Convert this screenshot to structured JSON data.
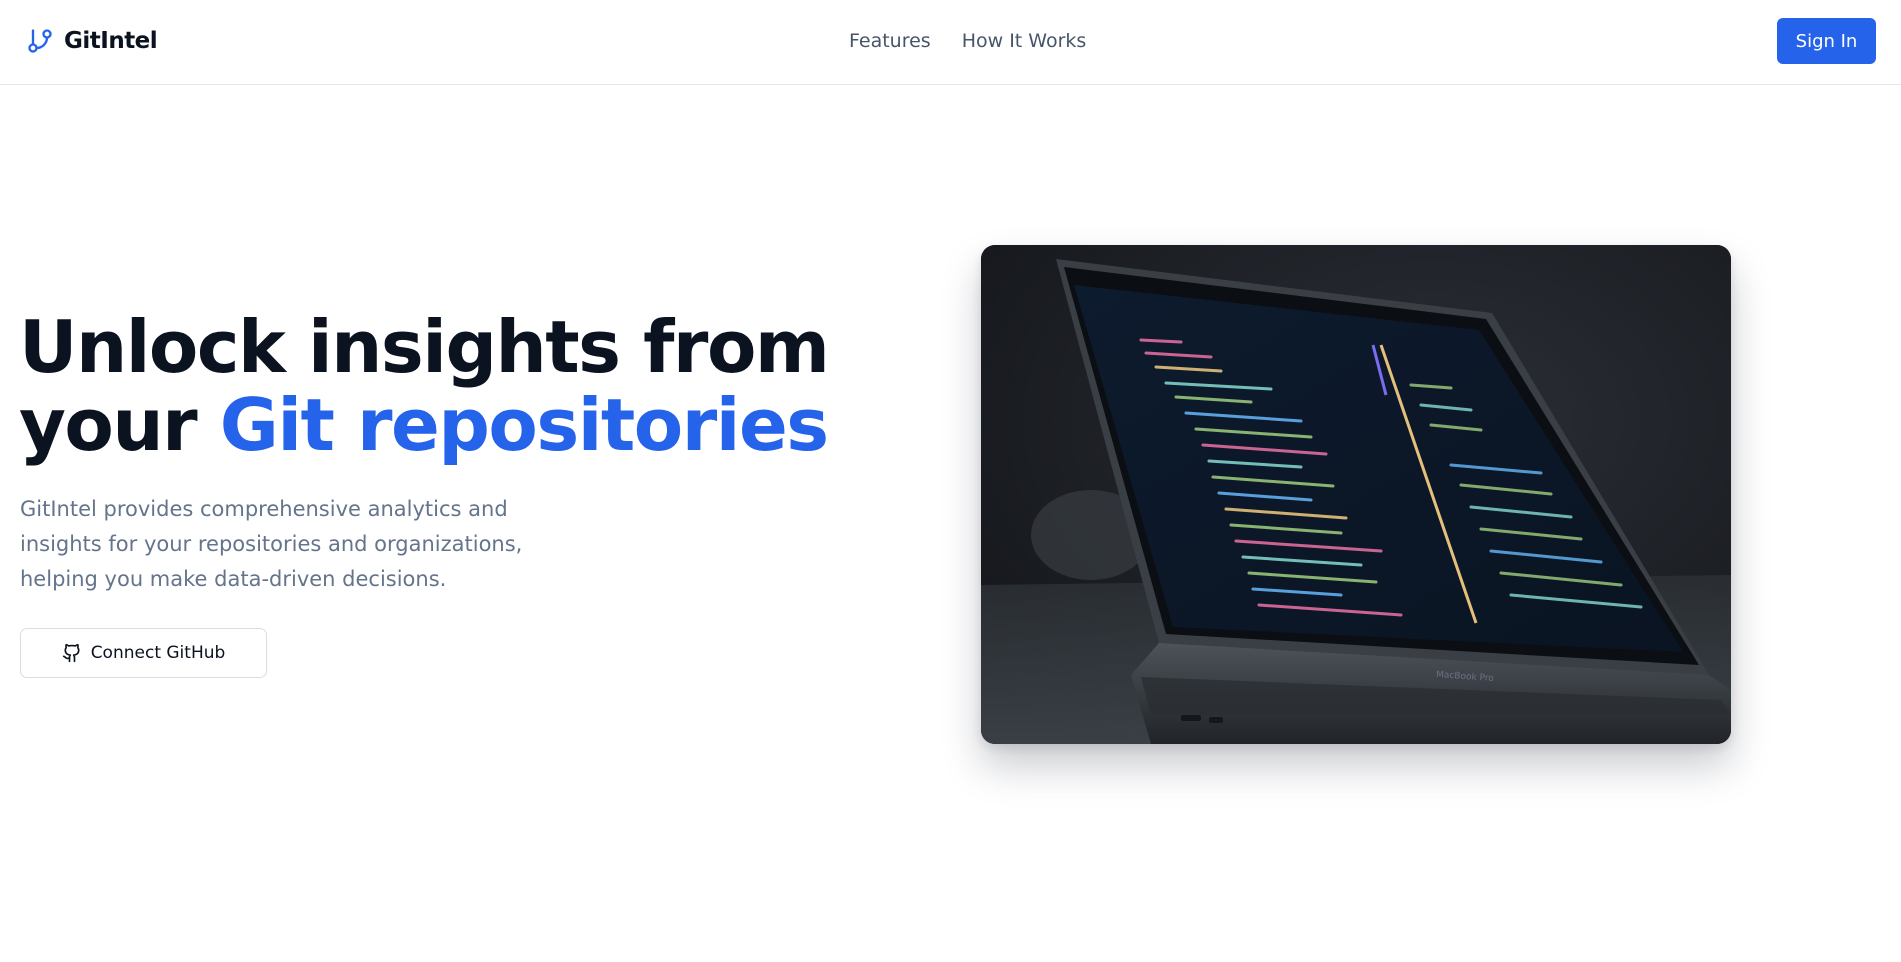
{
  "header": {
    "brand": "GitIntel",
    "brand_icon": "git-branch-icon",
    "nav": [
      "Features",
      "How It Works"
    ],
    "signin_label": "Sign In"
  },
  "hero": {
    "title_line1": "Unlock insights from",
    "title_line2_prefix": "your ",
    "title_line2_accent": "Git repositories",
    "description": "GitIntel provides comprehensive analytics and insights for your repositories and organizations, helping you make data-driven decisions.",
    "cta_label": "Connect GitHub",
    "cta_icon": "github-icon",
    "image": {
      "subject": "laptop with code editor",
      "laptop_brand": "MacBook Pro"
    }
  },
  "colors": {
    "accent": "#2563eb",
    "title": "#0b1220",
    "muted": "#64748b",
    "border": "#e5e7eb"
  }
}
